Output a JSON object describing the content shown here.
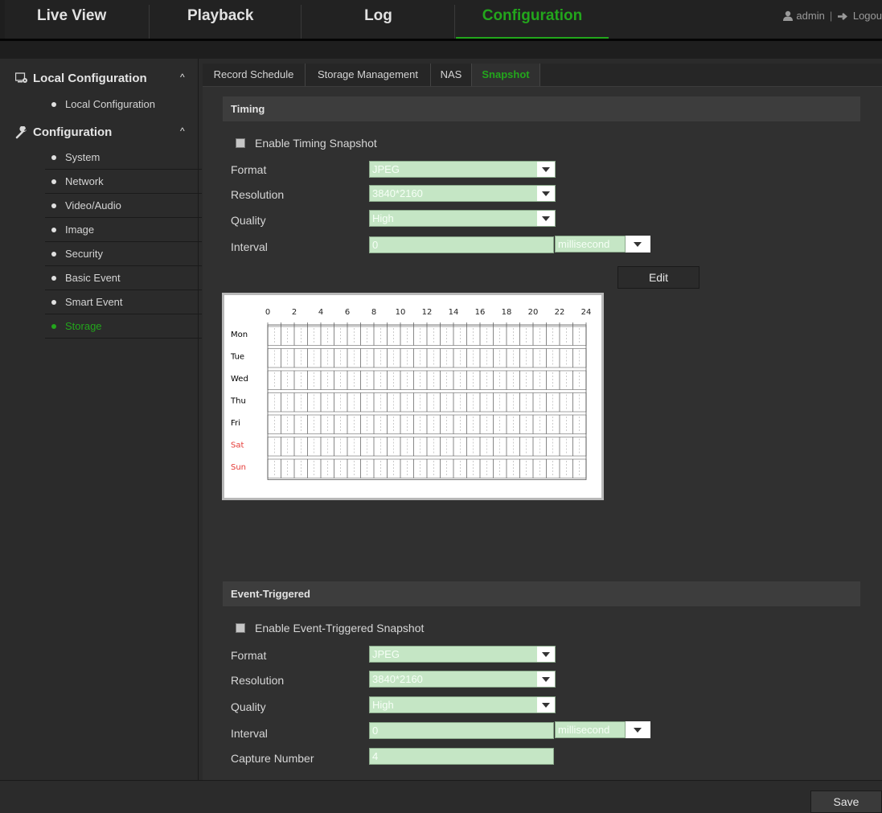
{
  "nav": {
    "tabs": [
      {
        "label": "Live View"
      },
      {
        "label": "Playback"
      },
      {
        "label": "Log"
      },
      {
        "label": "Configuration"
      }
    ],
    "user": "admin",
    "separator": "|",
    "logout": "Logou",
    "active_color": "#23a61c"
  },
  "sidebar": {
    "groups": [
      {
        "label": "Local Configuration",
        "icon": "local-config-icon",
        "caret": "^"
      },
      {
        "label": "Configuration",
        "icon": "wrench-icon",
        "caret": "^"
      }
    ],
    "local_items": [
      {
        "label": "Local Configuration"
      }
    ],
    "config_items": [
      {
        "label": "System"
      },
      {
        "label": "Network"
      },
      {
        "label": "Video/Audio"
      },
      {
        "label": "Image"
      },
      {
        "label": "Security"
      },
      {
        "label": "Basic Event"
      },
      {
        "label": "Smart Event"
      },
      {
        "label": "Storage"
      }
    ]
  },
  "subtabs": [
    {
      "label": "Record Schedule"
    },
    {
      "label": "Storage Management"
    },
    {
      "label": "NAS"
    },
    {
      "label": "Snapshot"
    }
  ],
  "timing": {
    "title": "Timing",
    "enable_label": "Enable Timing Snapshot",
    "enabled": false,
    "format_label": "Format",
    "format_value": "JPEG",
    "resolution_label": "Resolution",
    "resolution_value": "3840*2160",
    "quality_label": "Quality",
    "quality_value": "High",
    "interval_label": "Interval",
    "interval_value": "0",
    "interval_unit": "millisecond",
    "edit_label": "Edit"
  },
  "schedule": {
    "hours": [
      "0",
      "2",
      "4",
      "6",
      "8",
      "10",
      "12",
      "14",
      "16",
      "18",
      "20",
      "22",
      "24"
    ],
    "days": [
      {
        "label": "Mon",
        "color": "#000000"
      },
      {
        "label": "Tue",
        "color": "#000000"
      },
      {
        "label": "Wed",
        "color": "#000000"
      },
      {
        "label": "Thu",
        "color": "#000000"
      },
      {
        "label": "Fri",
        "color": "#000000"
      },
      {
        "label": "Sat",
        "color": "#e53935"
      },
      {
        "label": "Sun",
        "color": "#e53935"
      }
    ]
  },
  "event": {
    "title": "Event-Triggered",
    "enable_label": "Enable Event-Triggered Snapshot",
    "enabled": false,
    "format_label": "Format",
    "format_value": "JPEG",
    "resolution_label": "Resolution",
    "resolution_value": "3840*2160",
    "quality_label": "Quality",
    "quality_value": "High",
    "interval_label": "Interval",
    "interval_value": "0",
    "interval_unit": "millisecond",
    "capture_label": "Capture Number",
    "capture_value": "4"
  },
  "save_label": "Save"
}
